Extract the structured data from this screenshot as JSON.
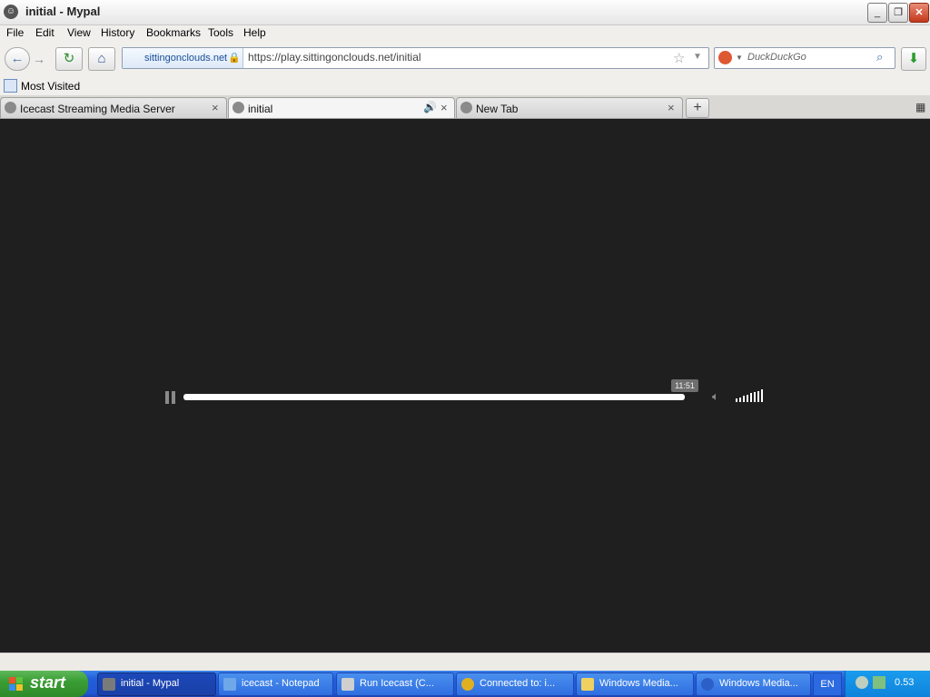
{
  "window": {
    "title": "initial - Mypal",
    "buttons": {
      "minimize": "_",
      "restore": "❐",
      "close": "✕"
    }
  },
  "menu": [
    "File",
    "Edit",
    "View",
    "History",
    "Bookmarks",
    "Tools",
    "Help"
  ],
  "navbar": {
    "back_icon": "back-arrow-icon",
    "forward_icon": "forward-arrow-icon",
    "reload_icon": "reload-icon",
    "home_icon": "home-icon",
    "identity_label": "sittingonclouds.net",
    "url": "https://play.sittingonclouds.net/initial",
    "search_engine": "DuckDuckGo",
    "search_placeholder": "DuckDuckGo",
    "download_icon": "download-arrow-icon"
  },
  "bookmarks": {
    "most_visited": "Most Visited"
  },
  "tabs": [
    {
      "label": "Icecast Streaming Media Server",
      "active": false,
      "audio": false
    },
    {
      "label": "initial",
      "active": true,
      "audio": true
    },
    {
      "label": "New Tab",
      "active": false,
      "audio": false
    }
  ],
  "player": {
    "time": "11:51",
    "progress_fraction": 1.0,
    "state": "playing",
    "volume_fraction": 1.0
  },
  "taskbar": {
    "start_label": "start",
    "items": [
      {
        "label": "initial - Mypal",
        "active": true,
        "icon_color": "#7a7a7a"
      },
      {
        "label": "icecast - Notepad",
        "active": false,
        "icon_color": "#6fa8e8"
      },
      {
        "label": "Run Icecast (C...",
        "active": false,
        "icon_color": "#cfcfcf"
      },
      {
        "label": "Connected to: i...",
        "active": false,
        "icon_color": "#e0b020"
      },
      {
        "label": "Windows Media...",
        "active": false,
        "icon_color": "#f0d060"
      },
      {
        "label": "Windows Media...",
        "active": false,
        "icon_color": "#2d5fc8"
      }
    ],
    "language": "EN",
    "clock": "0.53"
  }
}
